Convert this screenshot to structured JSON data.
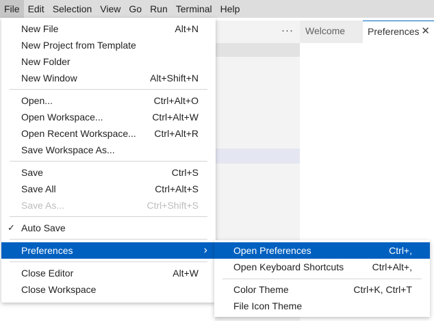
{
  "menubar": [
    "File",
    "Edit",
    "Selection",
    "View",
    "Go",
    "Run",
    "Terminal",
    "Help"
  ],
  "tabs": {
    "more": "···",
    "welcome": "Welcome",
    "preferences": "Preferences",
    "close": "✕"
  },
  "file_menu": {
    "new_file": {
      "label": "New File",
      "shortcut": "Alt+N"
    },
    "new_project": {
      "label": "New Project from Template"
    },
    "new_folder": {
      "label": "New Folder"
    },
    "new_window": {
      "label": "New Window",
      "shortcut": "Alt+Shift+N"
    },
    "open": {
      "label": "Open...",
      "shortcut": "Ctrl+Alt+O"
    },
    "open_workspace": {
      "label": "Open Workspace...",
      "shortcut": "Ctrl+Alt+W"
    },
    "open_recent": {
      "label": "Open Recent Workspace...",
      "shortcut": "Ctrl+Alt+R"
    },
    "save_workspace_as": {
      "label": "Save Workspace As..."
    },
    "save": {
      "label": "Save",
      "shortcut": "Ctrl+S"
    },
    "save_all": {
      "label": "Save All",
      "shortcut": "Ctrl+Alt+S"
    },
    "save_as": {
      "label": "Save As...",
      "shortcut": "Ctrl+Shift+S"
    },
    "auto_save": {
      "label": "Auto Save",
      "check": "✓"
    },
    "preferences": {
      "label": "Preferences",
      "chevron": "›"
    },
    "close_editor": {
      "label": "Close Editor",
      "shortcut": "Alt+W"
    },
    "close_workspace": {
      "label": "Close Workspace"
    }
  },
  "preferences_menu": {
    "open_preferences": {
      "label": "Open Preferences",
      "shortcut": "Ctrl+,"
    },
    "open_keyboard_shortcuts": {
      "label": "Open Keyboard Shortcuts",
      "shortcut": "Ctrl+Alt+,"
    },
    "color_theme": {
      "label": "Color Theme",
      "shortcut": "Ctrl+K, Ctrl+T"
    },
    "file_icon_theme": {
      "label": "File Icon Theme"
    }
  },
  "colors": {
    "accent": "#0060c0",
    "menubar": "#dddddd"
  }
}
